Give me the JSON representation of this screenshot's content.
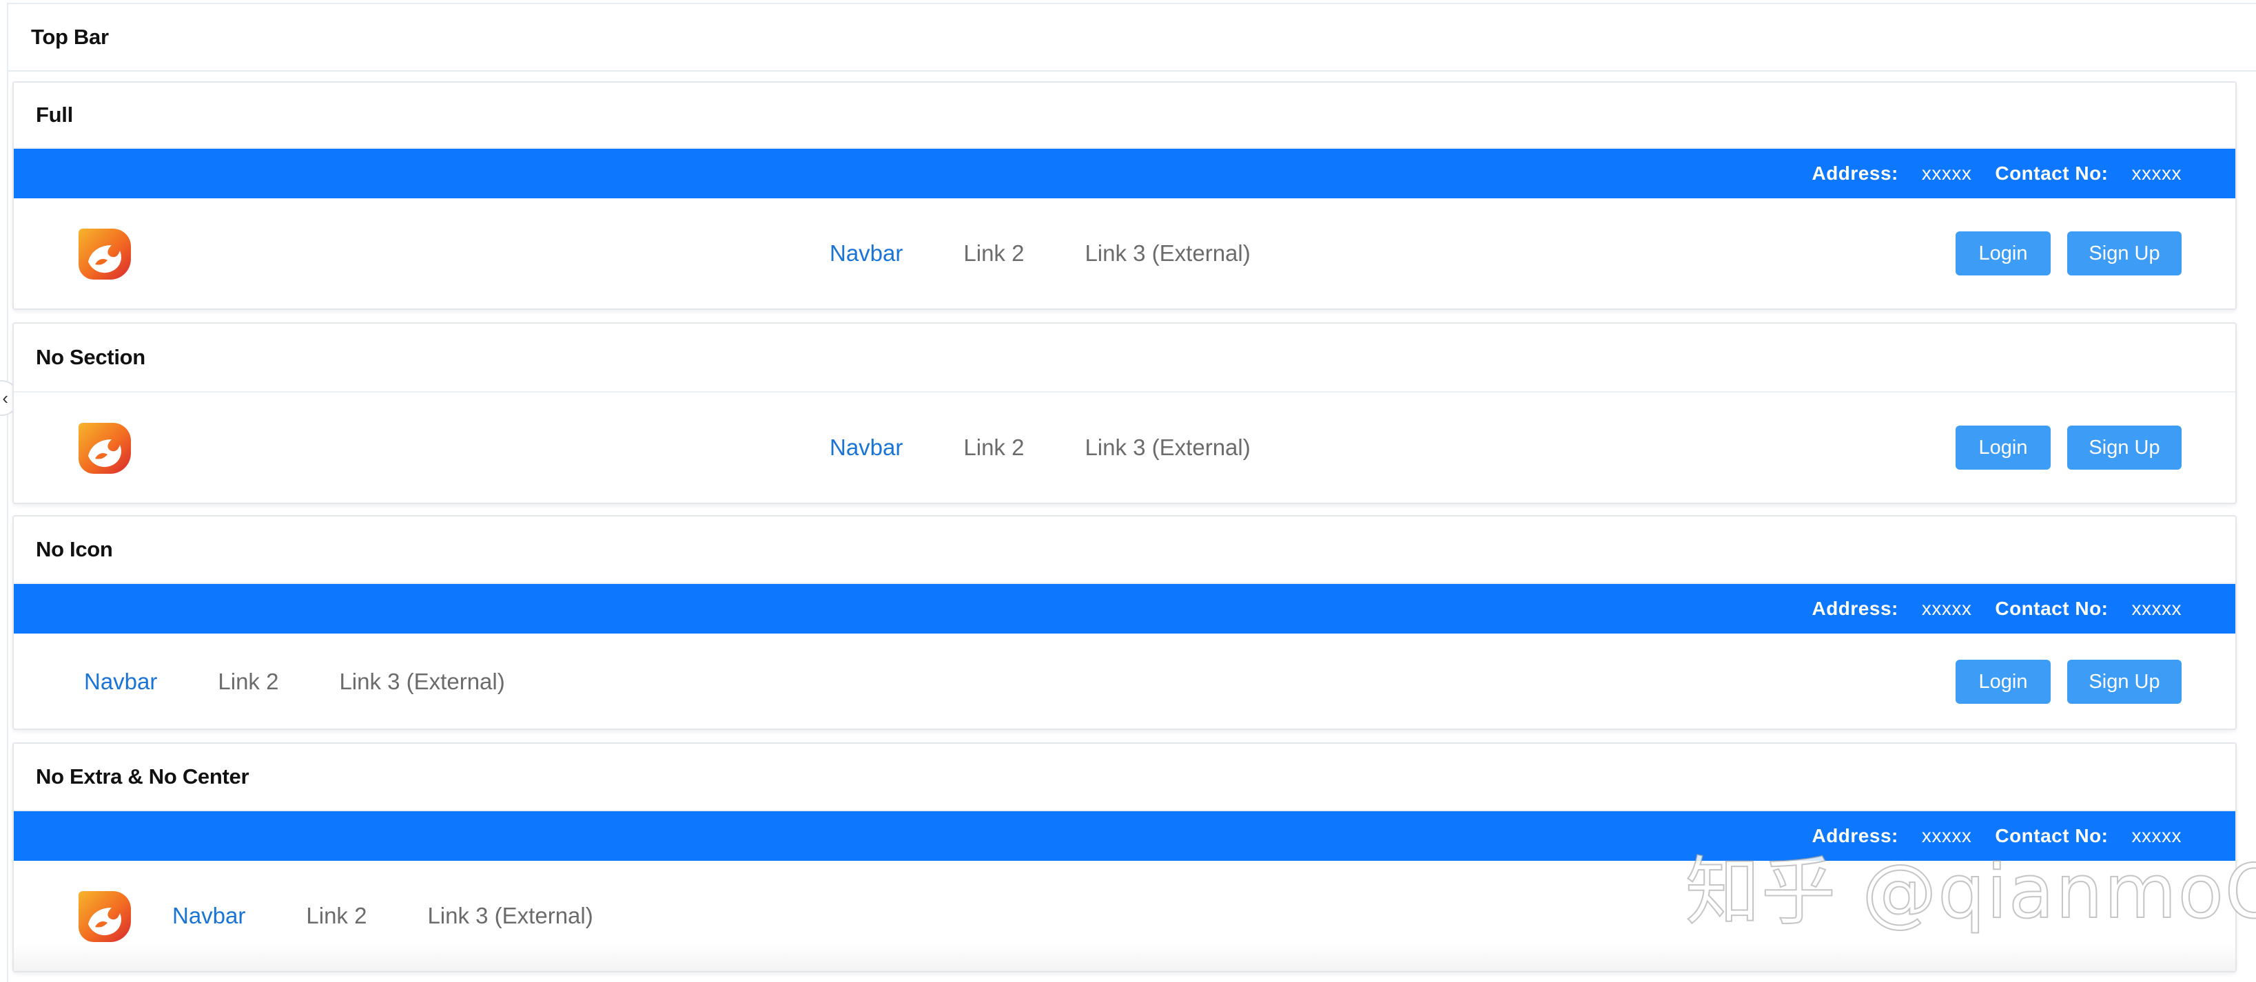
{
  "page": {
    "title": "Top Bar",
    "collapse_glyph": "‹"
  },
  "info": {
    "address_label": "Address:",
    "address_value": "xxxxx",
    "contact_label": "Contact No:",
    "contact_value": "xxxxx"
  },
  "nav": {
    "link1": "Navbar",
    "link2": "Link 2",
    "link3": "Link 3 (External)"
  },
  "buttons": {
    "login": "Login",
    "signup": "Sign Up"
  },
  "sections": [
    {
      "title": "Full"
    },
    {
      "title": "No Section"
    },
    {
      "title": "No Icon"
    },
    {
      "title": "No Extra & No Center"
    }
  ],
  "watermark": "知乎 @qianmoQ",
  "colors": {
    "info_bar": "#0d77fd",
    "button": "#3c9cf6",
    "active_link": "#1a73d6",
    "link": "#6b6b6b"
  },
  "icons": {
    "logo": "fox-flame-logo-icon",
    "collapse": "chevron-left-icon"
  }
}
